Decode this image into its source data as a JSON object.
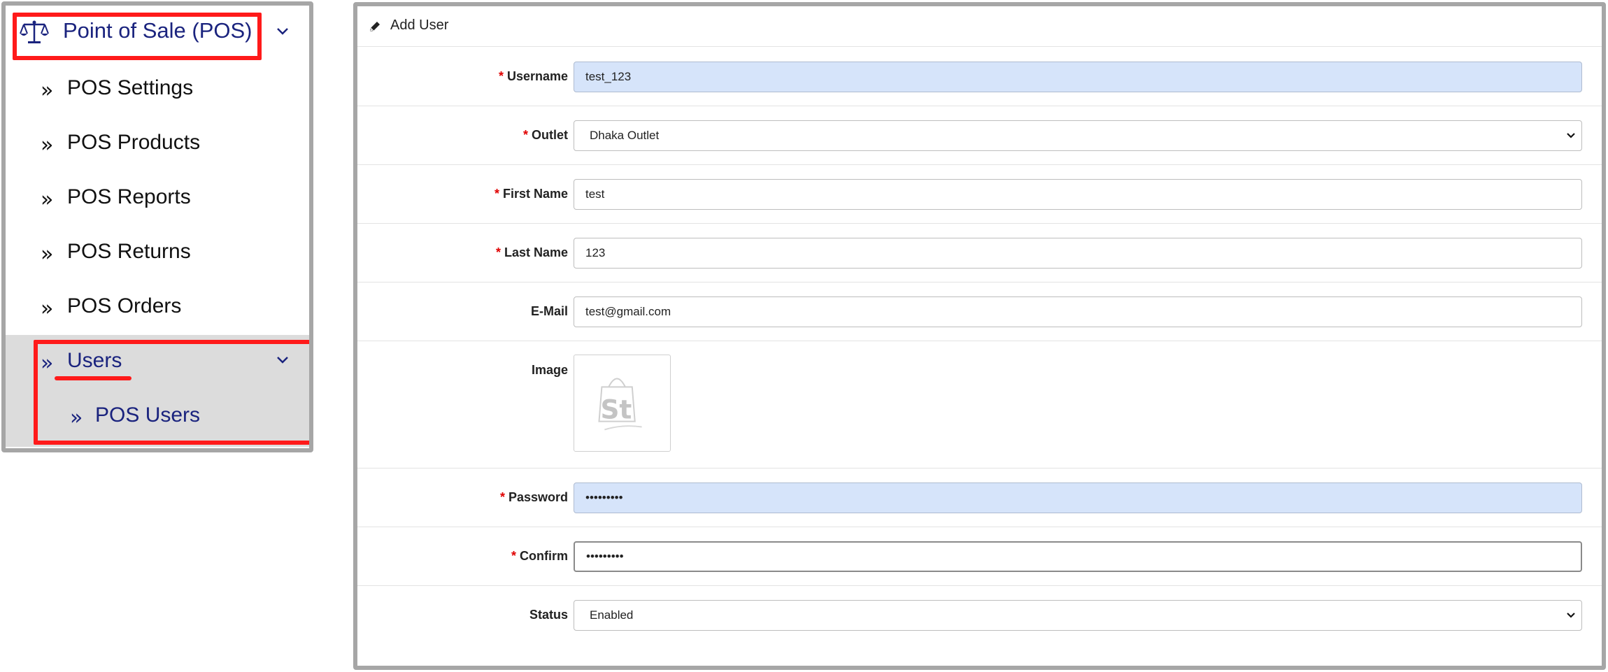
{
  "sidebar": {
    "header_title": "Point of Sale (POS)",
    "header_icon": "scale-icon",
    "items": [
      {
        "label": "POS Settings"
      },
      {
        "label": "POS Products"
      },
      {
        "label": "POS Reports"
      },
      {
        "label": "POS Returns"
      },
      {
        "label": "POS Orders"
      }
    ],
    "users_label": "Users",
    "users_children": [
      {
        "label": "POS Users"
      }
    ],
    "chevron_glyph": "»"
  },
  "form": {
    "title": "Add User",
    "title_icon": "pencil-icon",
    "required_mark": "*",
    "fields": {
      "username": {
        "label": "Username",
        "value": "test_123",
        "required": true
      },
      "outlet": {
        "label": "Outlet",
        "value": "Dhaka Outlet",
        "required": true
      },
      "first_name": {
        "label": "First Name",
        "value": "test",
        "required": true
      },
      "last_name": {
        "label": "Last Name",
        "value": "123",
        "required": true
      },
      "email": {
        "label": "E-Mail",
        "value": "test@gmail.com",
        "required": false
      },
      "image": {
        "label": "Image",
        "required": false
      },
      "password": {
        "label": "Password",
        "value": "•••••••••",
        "required": true
      },
      "confirm": {
        "label": "Confirm",
        "value": "•••••••••",
        "required": true
      },
      "status": {
        "label": "Status",
        "value": "Enabled",
        "required": false
      }
    }
  },
  "colors": {
    "nav_accent": "#1a237e",
    "highlight_red": "#ff1a1a",
    "required_red": "#e00000",
    "autofill_bg": "#d6e4fa",
    "users_section_bg": "#dcdcdc"
  }
}
